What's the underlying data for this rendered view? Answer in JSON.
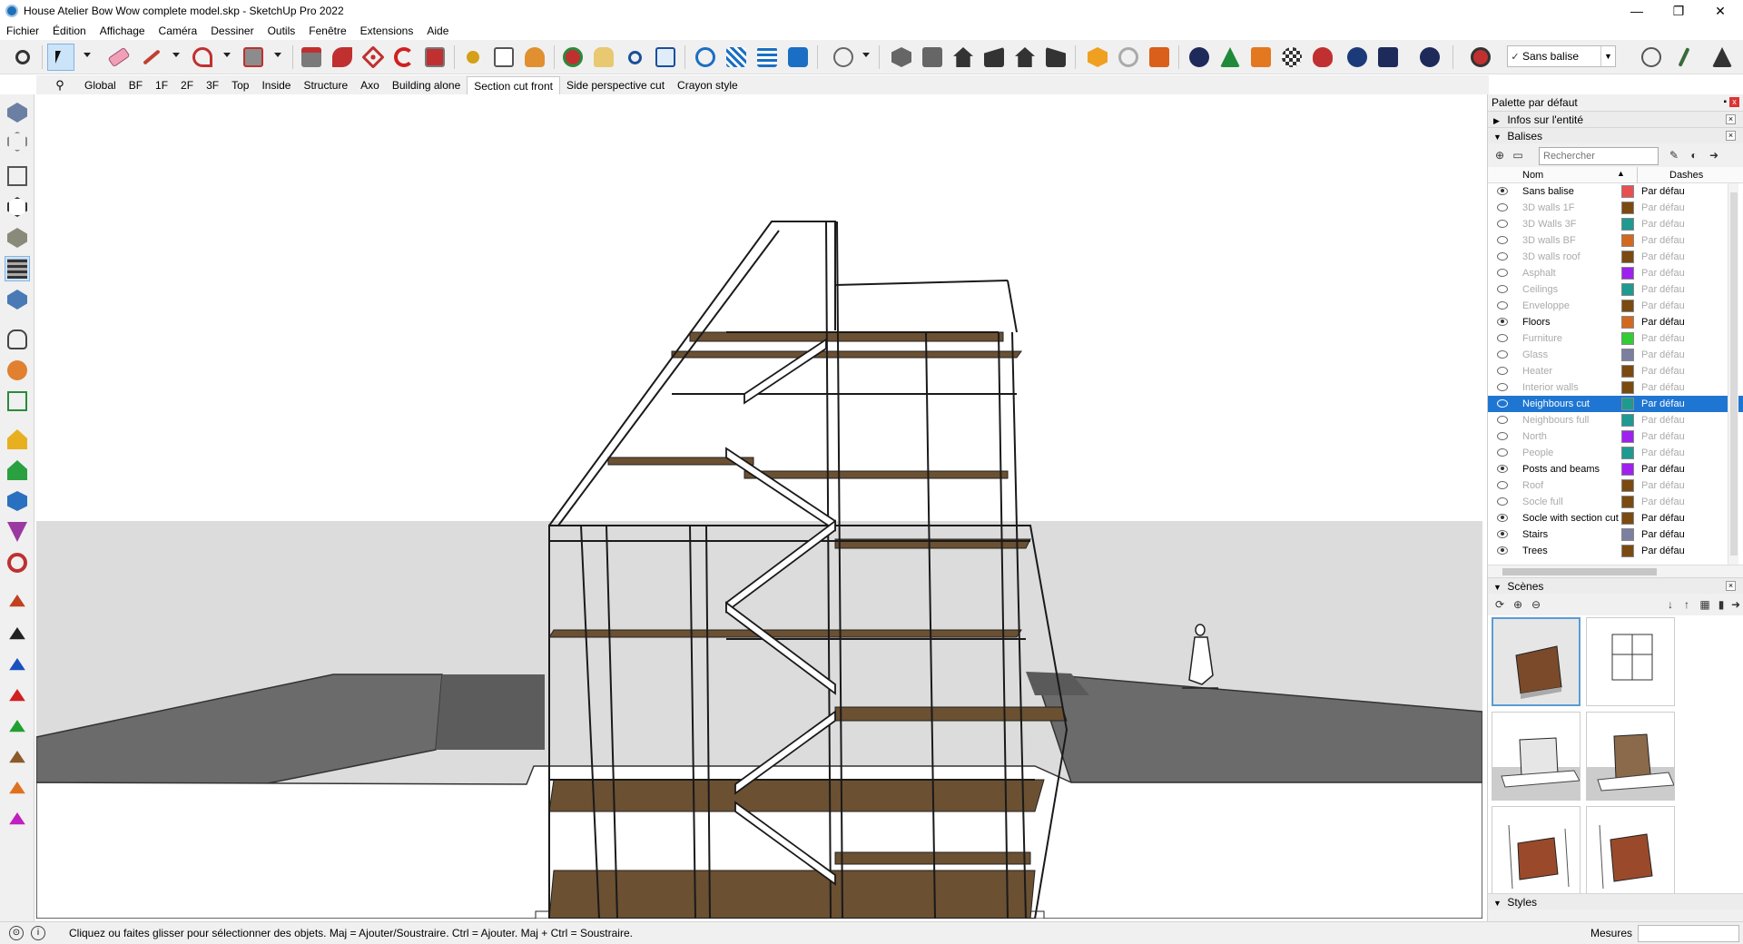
{
  "window": {
    "title": "House Atelier Bow Wow complete model.skp - SketchUp Pro 2022",
    "controls": [
      "—",
      "❐",
      "✕"
    ]
  },
  "menu": [
    "Fichier",
    "Édition",
    "Affichage",
    "Caméra",
    "Dessiner",
    "Outils",
    "Fenêtre",
    "Extensions",
    "Aide"
  ],
  "style_selector": {
    "label": "Sans balise",
    "checked": true
  },
  "scene_tabs": [
    "Global",
    "BF",
    "1F",
    "2F",
    "3F",
    "Top",
    "Inside",
    "Structure",
    "Axo",
    "Building alone",
    "Section cut front",
    "Side perspective cut",
    "Crayon style"
  ],
  "active_scene_tab": "Section cut front",
  "tray": {
    "title": "Palette par défaut",
    "pin": "▪",
    "close": "x",
    "entity_info": "Infos sur l'entité",
    "tags_section": "Balises",
    "search_placeholder": "Rechercher",
    "col_name": "Nom",
    "col_dashes": "Dashes",
    "sort_icon": "▲",
    "tags": [
      {
        "name": "Sans balise",
        "visible": true,
        "color": "#e85050",
        "dashes": "Par défaut"
      },
      {
        "name": "3D walls 1F",
        "visible": false,
        "color": "#7a4a10",
        "dashes": "Par défaut"
      },
      {
        "name": "3D Walls 3F",
        "visible": false,
        "color": "#1e9a90",
        "dashes": "Par défaut"
      },
      {
        "name": "3D walls BF",
        "visible": false,
        "color": "#d2691e",
        "dashes": "Par défaut"
      },
      {
        "name": "3D walls roof",
        "visible": false,
        "color": "#7a4a10",
        "dashes": "Par défaut"
      },
      {
        "name": "Asphalt",
        "visible": false,
        "color": "#a020f0",
        "dashes": "Par défaut"
      },
      {
        "name": "Ceilings",
        "visible": false,
        "color": "#1e9a90",
        "dashes": "Par défaut"
      },
      {
        "name": "Enveloppe",
        "visible": false,
        "color": "#7a4a10",
        "dashes": "Par défaut"
      },
      {
        "name": "Floors",
        "visible": true,
        "color": "#d2691e",
        "dashes": "Par défaut"
      },
      {
        "name": "Furniture",
        "visible": false,
        "color": "#32cd32",
        "dashes": "Par défaut"
      },
      {
        "name": "Glass",
        "visible": false,
        "color": "#7b7fa0",
        "dashes": "Par défaut"
      },
      {
        "name": "Heater",
        "visible": false,
        "color": "#7a4a10",
        "dashes": "Par défaut"
      },
      {
        "name": "Interior walls",
        "visible": false,
        "color": "#7a4a10",
        "dashes": "Par défaut"
      },
      {
        "name": "Neighbours cut",
        "visible": false,
        "color": "#1e9a90",
        "dashes": "Par défaut",
        "selected": true
      },
      {
        "name": "Neighbours full",
        "visible": false,
        "color": "#1e9a90",
        "dashes": "Par défaut"
      },
      {
        "name": "North",
        "visible": false,
        "color": "#a020f0",
        "dashes": "Par défaut"
      },
      {
        "name": "People",
        "visible": false,
        "color": "#1e9a90",
        "dashes": "Par défaut"
      },
      {
        "name": "Posts and beams",
        "visible": true,
        "color": "#a020f0",
        "dashes": "Par défaut"
      },
      {
        "name": "Roof",
        "visible": false,
        "color": "#7a4a10",
        "dashes": "Par défaut"
      },
      {
        "name": "Socle full",
        "visible": false,
        "color": "#7a4a10",
        "dashes": "Par défaut"
      },
      {
        "name": "Socle with section cut",
        "visible": true,
        "color": "#7a4a10",
        "dashes": "Par défaut"
      },
      {
        "name": "Stairs",
        "visible": true,
        "color": "#7b7fa0",
        "dashes": "Par défaut"
      },
      {
        "name": "Trees",
        "visible": true,
        "color": "#7a4a10",
        "dashes": "Par défaut"
      }
    ],
    "scenes_section": "Scènes",
    "styles_section": "Styles"
  },
  "status": {
    "hint": "Cliquez ou faites glisser pour sélectionner des objets. Maj = Ajouter/Soustraire. Ctrl = Ajouter. Maj + Ctrl = Soustraire.",
    "measures_label": "Mesures",
    "measures_value": ""
  },
  "colors": {
    "selection_blue": "#1f76d2",
    "sky": "#ffffff",
    "horizon": "#dcdcdc",
    "ground": "#6b6b6b",
    "floor_wood": "#6b5032"
  }
}
